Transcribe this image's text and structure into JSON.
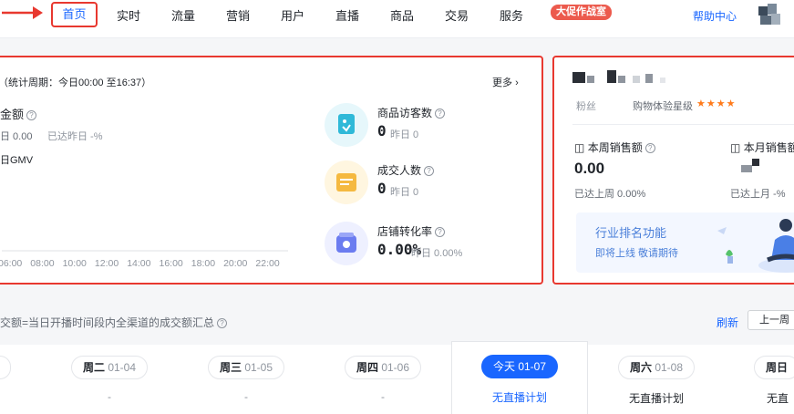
{
  "nav": {
    "items": [
      "首页",
      "实时",
      "流量",
      "营销",
      "用户",
      "直播",
      "商品",
      "交易",
      "服务"
    ],
    "badge": "大促作战室",
    "help": "帮助中心"
  },
  "overview": {
    "period": "（统计周期：今日00:00 至16:37）",
    "more": "更多",
    "gmv_label": "金额",
    "gmv_yesterday": "日 0.00",
    "gmv_reached": "已达昨日 -%",
    "legend": "日GMV",
    "x_ticks": [
      "06:00",
      "08:00",
      "10:00",
      "12:00",
      "14:00",
      "16:00",
      "18:00",
      "20:00",
      "22:00"
    ],
    "metrics": [
      {
        "name": "商品访客数",
        "value": "0",
        "sub": "昨日 0",
        "icon": "shop-visitor-icon",
        "color": "#e6f7fb"
      },
      {
        "name": "成交人数",
        "value": "0",
        "sub": "昨日 0",
        "icon": "buyer-icon",
        "color": "#fff6e0"
      },
      {
        "name": "店铺转化率",
        "value": "0.00%",
        "sub": "昨日 0.00%",
        "icon": "conversion-icon",
        "color": "#eef0ff"
      }
    ]
  },
  "shop": {
    "fans_label": "粉丝",
    "stars_label": "购物体验星级",
    "stars": "★★★★",
    "week_label": "本周销售额",
    "week_value": "0.00",
    "week_sub": "已达上周 0.00%",
    "month_label": "本月销售额",
    "month_sub": "已达上月 -%",
    "rank_title": "行业排名功能",
    "rank_sub": "即将上线 敬请期待"
  },
  "live": {
    "desc": "交额=当日开播时间段内全渠道的成交额汇总",
    "refresh": "刷新",
    "prev_week": "上一周",
    "days": [
      {
        "name": "周二",
        "date": "01-04",
        "status": "-"
      },
      {
        "name": "周三",
        "date": "01-05",
        "status": "-"
      },
      {
        "name": "周四",
        "date": "01-06",
        "status": "-"
      },
      {
        "name": "今天",
        "date": "01-07",
        "status": "无直播计划"
      },
      {
        "name": "周六",
        "date": "01-08",
        "status": "无直播计划"
      },
      {
        "name": "周日",
        "date": "",
        "status": "无直"
      }
    ]
  }
}
